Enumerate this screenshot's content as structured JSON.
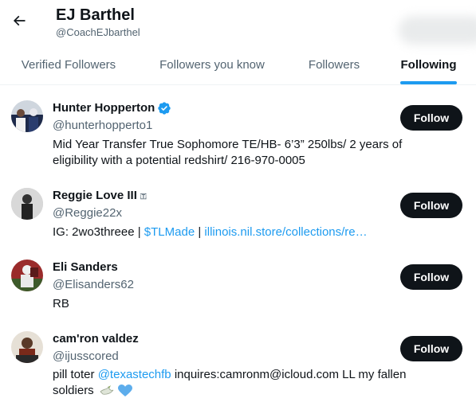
{
  "header": {
    "title": "EJ Barthel",
    "subtitle": "@CoachEJbarthel"
  },
  "tabs": [
    {
      "label": "Verified Followers"
    },
    {
      "label": "Followers you know"
    },
    {
      "label": "Followers"
    },
    {
      "label": "Following",
      "active": true
    }
  ],
  "users": [
    {
      "name": "Hunter Hopperton",
      "verified": true,
      "handle": "@hunterhopperto1",
      "bio_line1": "Mid Year Transfer True Sophomore TE/HB- 6’3” 250lbs/ 2 years of",
      "bio_line2": "eligibility with a potential redshirt/ 216-970-0005",
      "follow_label": "Follow"
    },
    {
      "name": "Reggie Love III",
      "name_suffix": "🇹",
      "handle": "@Reggie22x",
      "bio_prefix": "IG: 2wo3threee | ",
      "bio_link1": "$TLMade",
      "bio_sep": " | ",
      "bio_link2": "illinois.nil.store/collections/re…",
      "follow_label": "Follow"
    },
    {
      "name": "Eli Sanders",
      "handle": "@Elisanders62",
      "bio": "RB",
      "follow_label": "Follow"
    },
    {
      "name": "cam'ron valdez",
      "handle": "@ijusscored",
      "bio_prefix": "pill toter ",
      "bio_link": "@texastechfb",
      "bio_suffix": " inquires:camronm@icloud.com LL my fallen",
      "bio_line2": "soldiers",
      "follow_label": "Follow"
    }
  ],
  "colors": {
    "accent": "#1d9bf0",
    "text": "#0f1419",
    "muted": "#536471",
    "button": "#0f1419"
  }
}
